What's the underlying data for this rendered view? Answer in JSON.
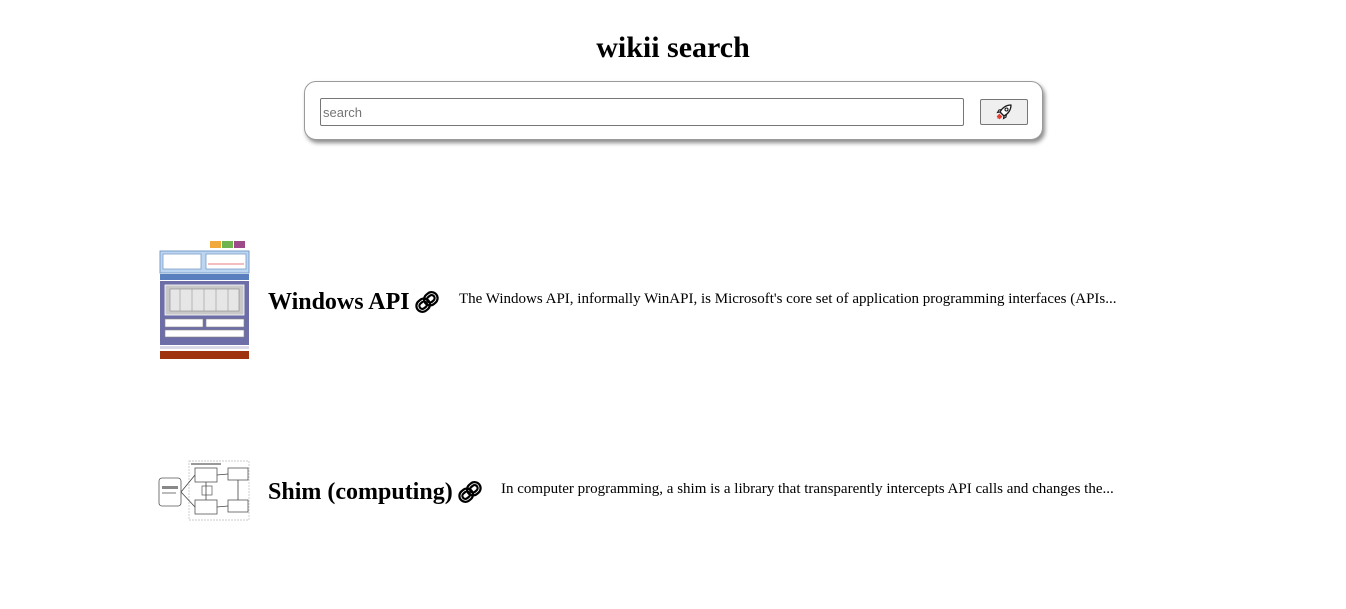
{
  "app": {
    "title": "wikii search"
  },
  "search": {
    "placeholder": "search",
    "value": "",
    "button_icon": "rocket-icon"
  },
  "results": [
    {
      "title": "Windows API",
      "snippet": "The Windows API, informally WinAPI, is Microsoft's core set of application programming interfaces (APIs...",
      "thumbnail_icon": "architecture-diagram-thumbnail",
      "link_icon": "link-icon"
    },
    {
      "title": "Shim (computing)",
      "snippet": "In computer programming, a shim is a library that transparently intercepts API calls and changes the...",
      "thumbnail_icon": "flowchart-thumbnail",
      "link_icon": "link-icon"
    }
  ]
}
